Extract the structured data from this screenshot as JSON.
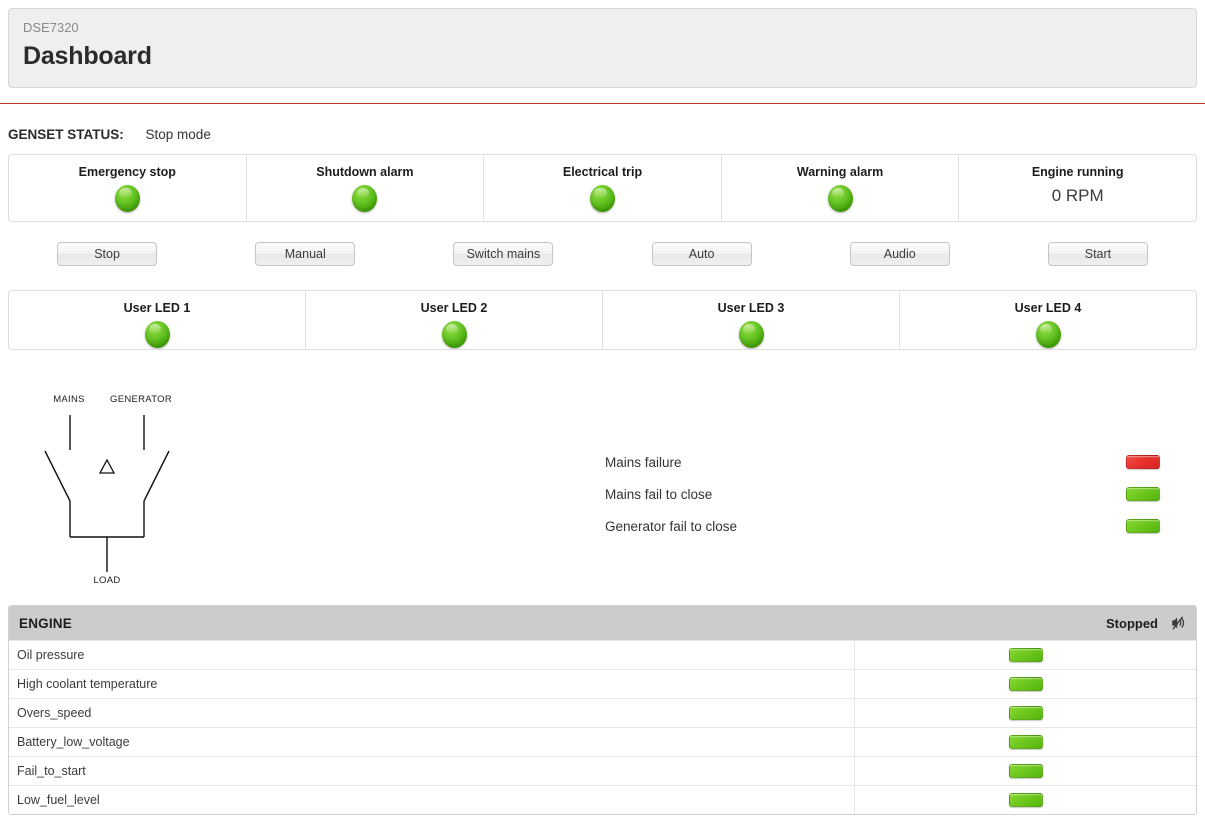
{
  "header": {
    "subtitle": "DSE7320",
    "title": "Dashboard"
  },
  "genset": {
    "label": "GENSET STATUS:",
    "value": "Stop mode"
  },
  "status_panel": {
    "cells": [
      {
        "label": "Emergency stop",
        "indicator": "led-round-green"
      },
      {
        "label": "Shutdown alarm",
        "indicator": "led-round-green"
      },
      {
        "label": "Electrical trip",
        "indicator": "led-round-green"
      },
      {
        "label": "Warning alarm",
        "indicator": "led-round-green"
      },
      {
        "label": "Engine running",
        "value": "0 RPM",
        "indicator": "none"
      }
    ]
  },
  "controls": {
    "buttons": [
      {
        "label": "Stop"
      },
      {
        "label": "Manual"
      },
      {
        "label": "Switch mains"
      },
      {
        "label": "Auto"
      },
      {
        "label": "Audio"
      },
      {
        "label": "Start"
      }
    ]
  },
  "user_leds": {
    "cells": [
      {
        "label": "User LED 1",
        "indicator": "led-round-green"
      },
      {
        "label": "User LED 2",
        "indicator": "led-round-green"
      },
      {
        "label": "User LED 3",
        "indicator": "led-round-green"
      },
      {
        "label": "User LED 4",
        "indicator": "led-round-green"
      }
    ]
  },
  "schematic": {
    "mains_label": "MAINS",
    "generator_label": "GENERATOR",
    "load_label": "LOAD",
    "symbol": "delta-triangle"
  },
  "alarms": {
    "rows": [
      {
        "name": "Mains failure",
        "state": "red"
      },
      {
        "name": "Mains fail to close",
        "state": "green"
      },
      {
        "name": "Generator fail to close",
        "state": "green"
      }
    ]
  },
  "engine": {
    "title": "ENGINE",
    "state": "Stopped",
    "icon": "speaker-mute-icon",
    "rows": [
      {
        "name": "Oil pressure",
        "state": "green"
      },
      {
        "name": "High coolant temperature",
        "state": "green"
      },
      {
        "name": "Overs_speed",
        "state": "green"
      },
      {
        "name": "Battery_low_voltage",
        "state": "green"
      },
      {
        "name": "Fail_to_start",
        "state": "green"
      },
      {
        "name": "Low_fuel_level",
        "state": "green"
      }
    ]
  },
  "colors": {
    "led_green": "#6dc92b",
    "led_red": "#e8342c",
    "accent_rule": "#c9342a",
    "header_bg": "#efefef",
    "section_header_bg": "#cccccc"
  }
}
